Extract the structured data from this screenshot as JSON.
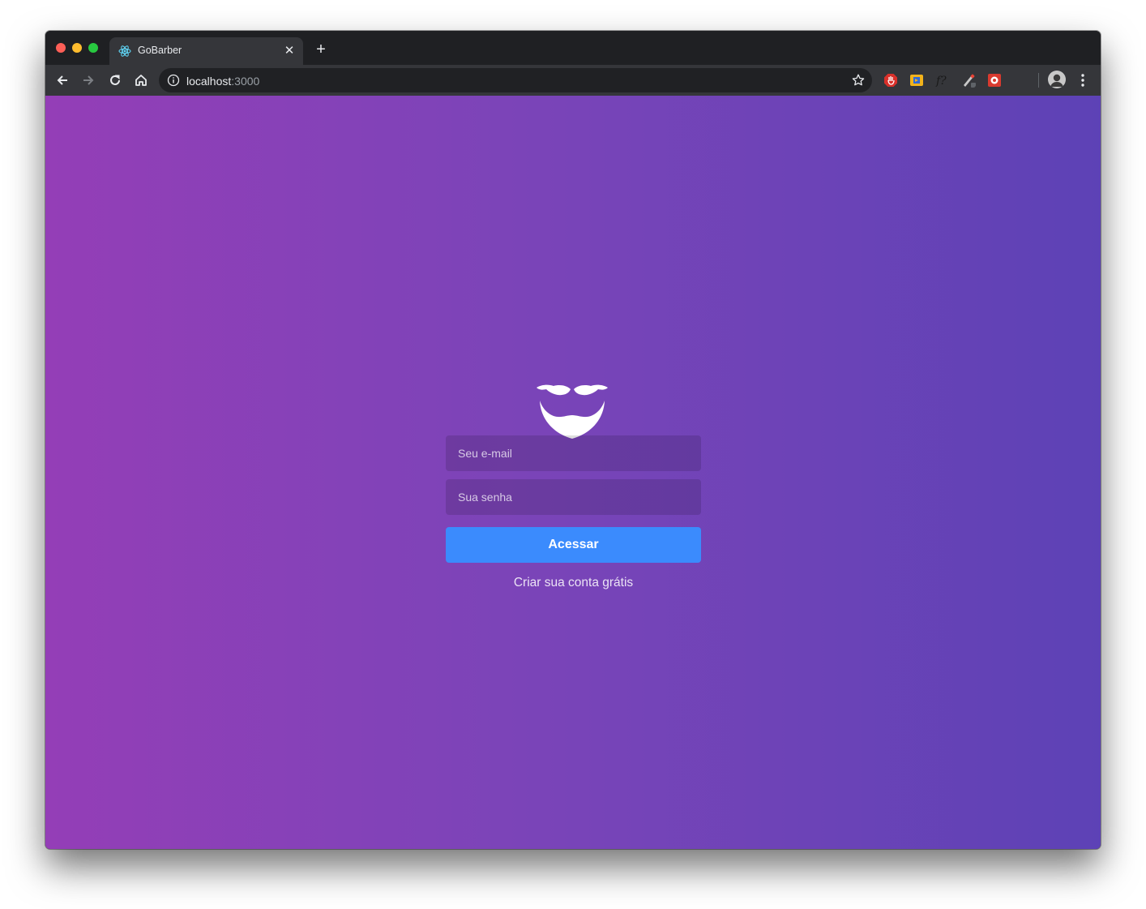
{
  "browser": {
    "tab_title": "GoBarber",
    "url_host": "localhost",
    "url_port": ":3000",
    "icons": [
      "react-favicon-icon",
      "close-icon",
      "plus-icon",
      "back-arrow-icon",
      "forward-arrow-icon",
      "reload-icon",
      "home-icon",
      "info-icon",
      "bookmark-star-icon",
      "adblock-extension-icon",
      "extension-icon",
      "whatfont-extension-icon",
      "colorpicker-extension-icon",
      "extension-icon",
      "profile-avatar-icon",
      "kebab-menu-icon"
    ]
  },
  "login": {
    "logo_icon": "mustache-beard-logo",
    "email_placeholder": "Seu e-mail",
    "password_placeholder": "Sua senha",
    "submit_label": "Acessar",
    "signup_link": "Criar sua conta grátis"
  },
  "colors": {
    "gradient_start": "#943eb7",
    "gradient_end": "#5d42b6",
    "button": "#3b8bfd"
  }
}
